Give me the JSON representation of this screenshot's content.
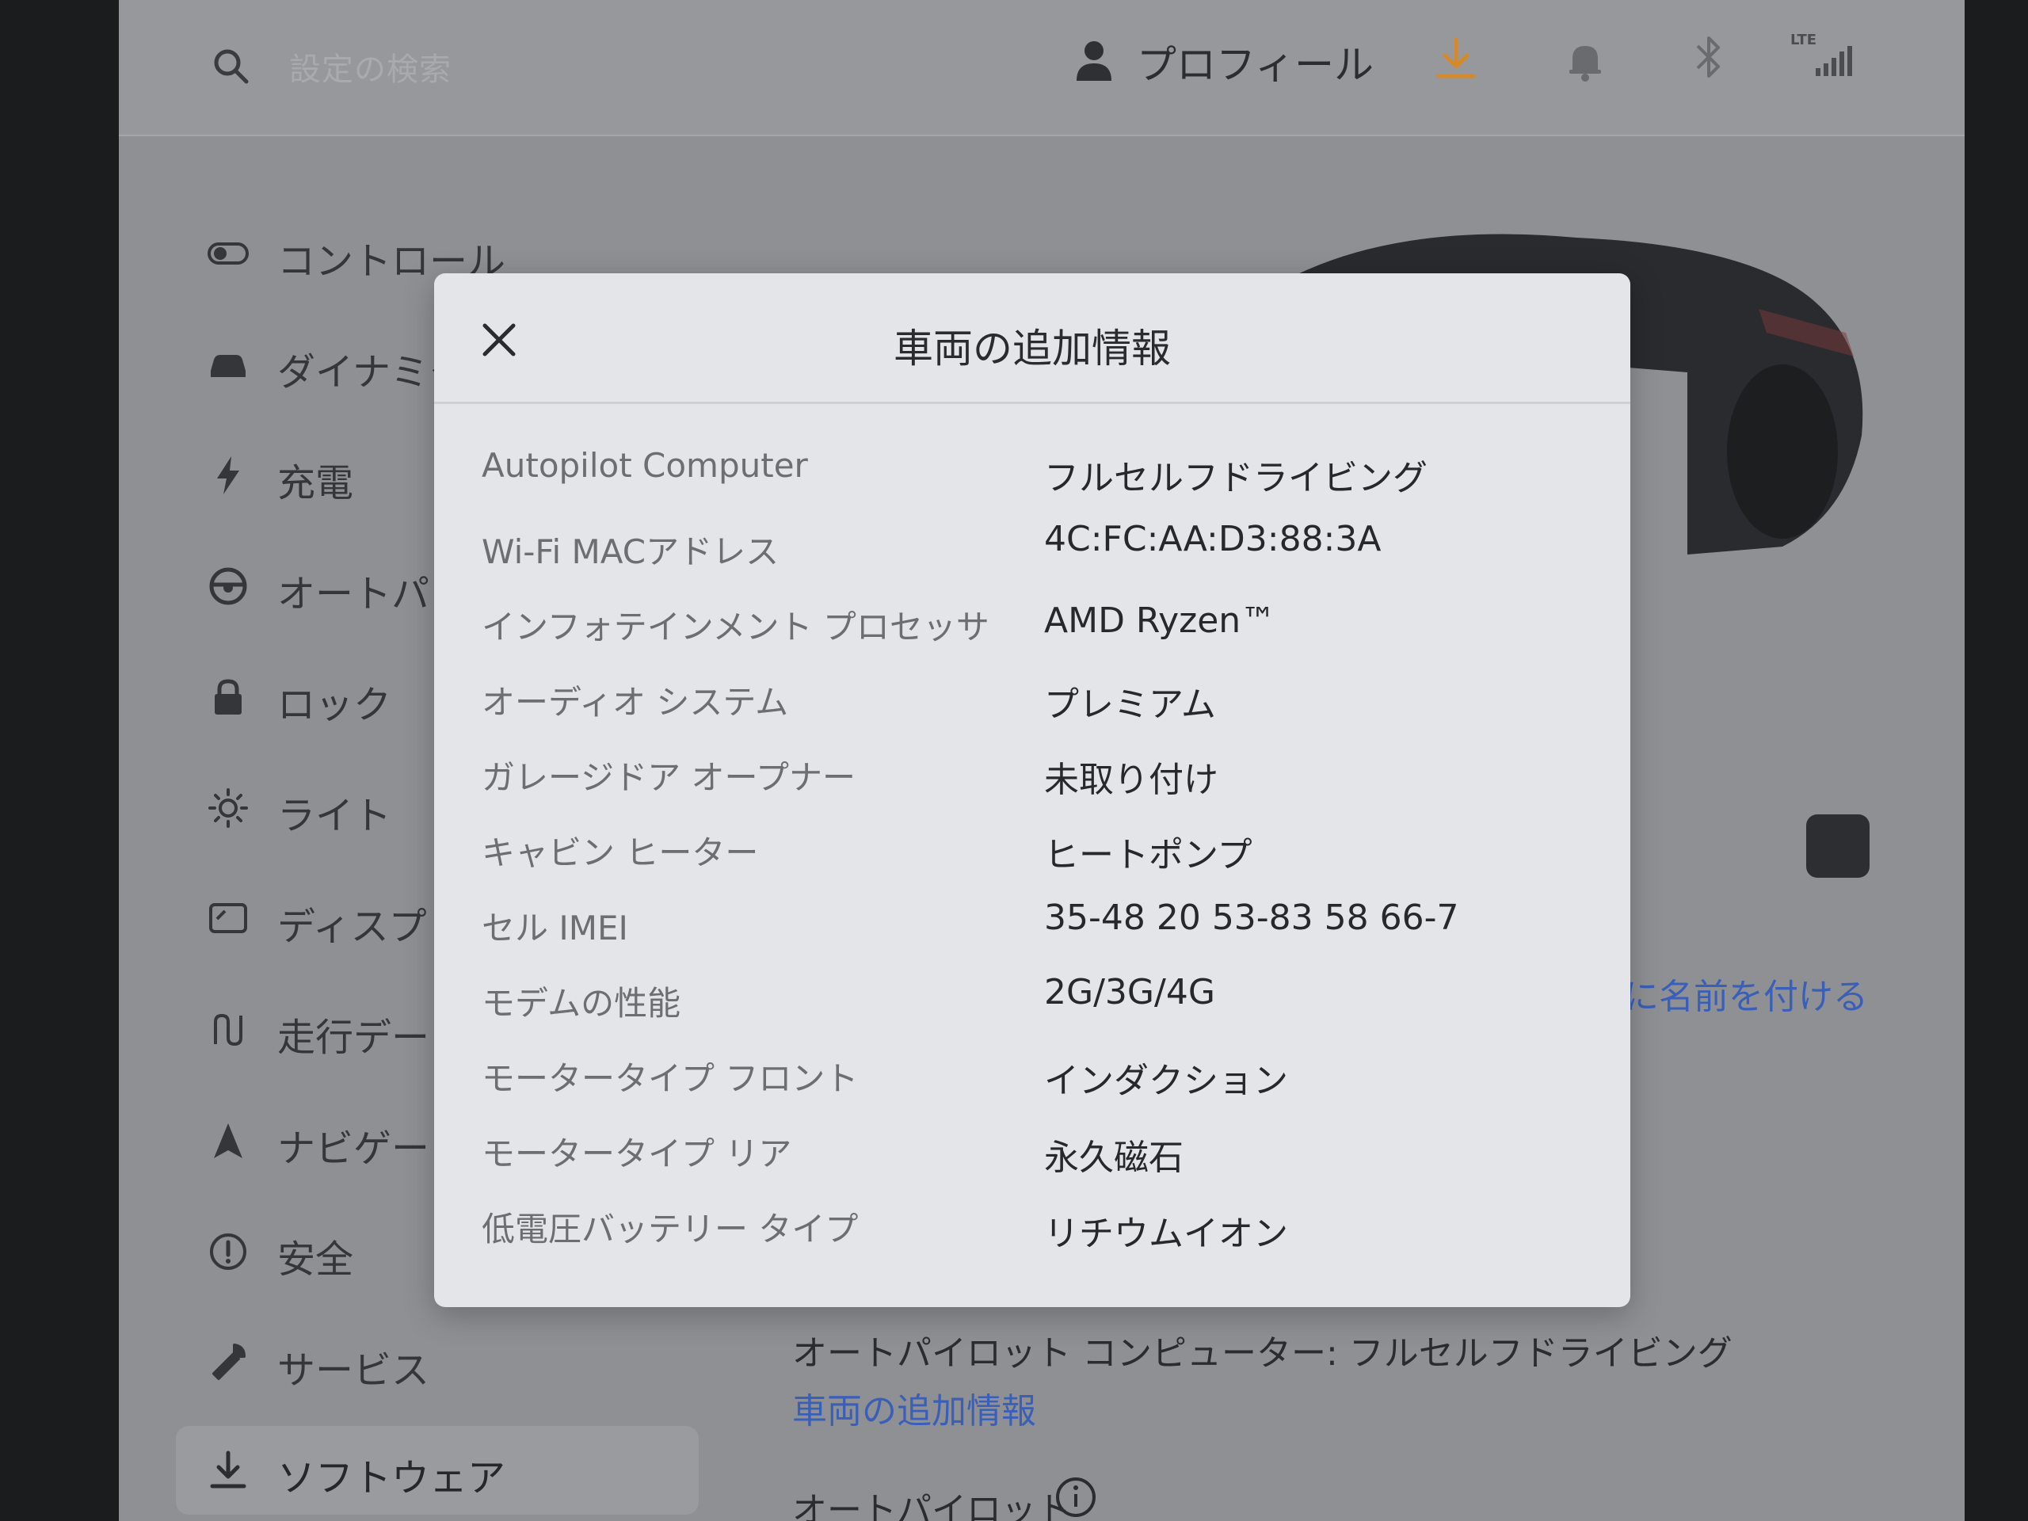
{
  "topbar": {
    "search_placeholder": "設定の検索",
    "profile_label": "プロフィール",
    "network_label": "LTE"
  },
  "sidebar": {
    "items": [
      {
        "label": "コントロール",
        "icon": "toggle-icon"
      },
      {
        "label": "ダイナミク",
        "icon": "car-icon"
      },
      {
        "label": "充電",
        "icon": "lightning-icon"
      },
      {
        "label": "オートパ",
        "icon": "steering-wheel-icon"
      },
      {
        "label": "ロック",
        "icon": "lock-icon"
      },
      {
        "label": "ライト",
        "icon": "sun-icon"
      },
      {
        "label": "ディスプレ",
        "icon": "display-icon"
      },
      {
        "label": "走行デー",
        "icon": "trips-icon"
      },
      {
        "label": "ナビゲー",
        "icon": "navigation-icon"
      },
      {
        "label": "安全",
        "icon": "alert-circle-icon"
      },
      {
        "label": "サービス",
        "icon": "wrench-icon"
      },
      {
        "label": "ソフトウェア",
        "icon": "download-icon"
      }
    ]
  },
  "background": {
    "rename_link": "に名前を付ける",
    "autopilot_computer_line": "オートパイロット コンピューター: フルセルフドライビング",
    "extra_info_link": "車両の追加情報",
    "autopilot_heading": "オートパイロット"
  },
  "modal": {
    "title": "車両の追加情報",
    "rows": [
      {
        "label": "Autopilot Computer",
        "value": "フルセルフドライビング"
      },
      {
        "label": "Wi-Fi MACアドレス",
        "value": "4C:FC:AA:D3:88:3A"
      },
      {
        "label": "インフォテインメント プロセッサ",
        "value": "AMD Ryzen™"
      },
      {
        "label": "オーディオ システム",
        "value": "プレミアム"
      },
      {
        "label": "ガレージドア オープナー",
        "value": "未取り付け"
      },
      {
        "label": "キャビン ヒーター",
        "value": "ヒートポンプ"
      },
      {
        "label": "セル IMEI",
        "value": "35-48 20 53-83 58 66-7"
      },
      {
        "label": "モデムの性能",
        "value": "2G/3G/4G"
      },
      {
        "label": "モータータイプ フロント",
        "value": "インダクション"
      },
      {
        "label": "モータータイプ リア",
        "value": "永久磁石"
      },
      {
        "label": "低電圧バッテリー タイプ",
        "value": "リチウムイオン"
      }
    ]
  },
  "colors": {
    "link": "#3a5fb8",
    "download_accent": "#d48a2a"
  }
}
